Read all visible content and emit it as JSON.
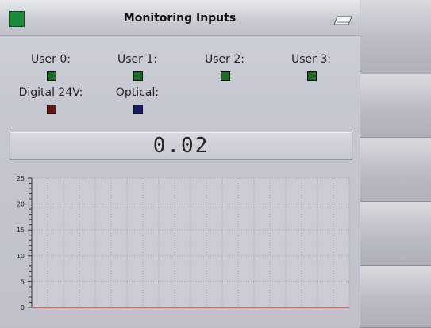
{
  "window": {
    "title": "Monitoring Inputs",
    "title_led_color": "#1f8a3a"
  },
  "inputs": [
    {
      "label": "User 0:",
      "led_color": "#1b6a27"
    },
    {
      "label": "User 1:",
      "led_color": "#1b6a27"
    },
    {
      "label": "User 2:",
      "led_color": "#1b6a27"
    },
    {
      "label": "User 3:",
      "led_color": "#1b6a27"
    },
    {
      "label": "Digital 24V:",
      "led_color": "#6a1515"
    },
    {
      "label": "Optical:",
      "led_color": "#171a6a"
    }
  ],
  "display": {
    "value": "0.02"
  },
  "chart_data": {
    "type": "line",
    "ylim": [
      0,
      25
    ],
    "y_ticks": [
      "0",
      "5",
      "10",
      "15",
      "20",
      "25"
    ],
    "grid": true,
    "series": [
      {
        "color": "#a02020",
        "x": [
          0,
          1
        ],
        "y": [
          0.02,
          0.02
        ]
      }
    ]
  },
  "side_buttons": [
    "",
    "",
    "",
    "",
    ""
  ]
}
